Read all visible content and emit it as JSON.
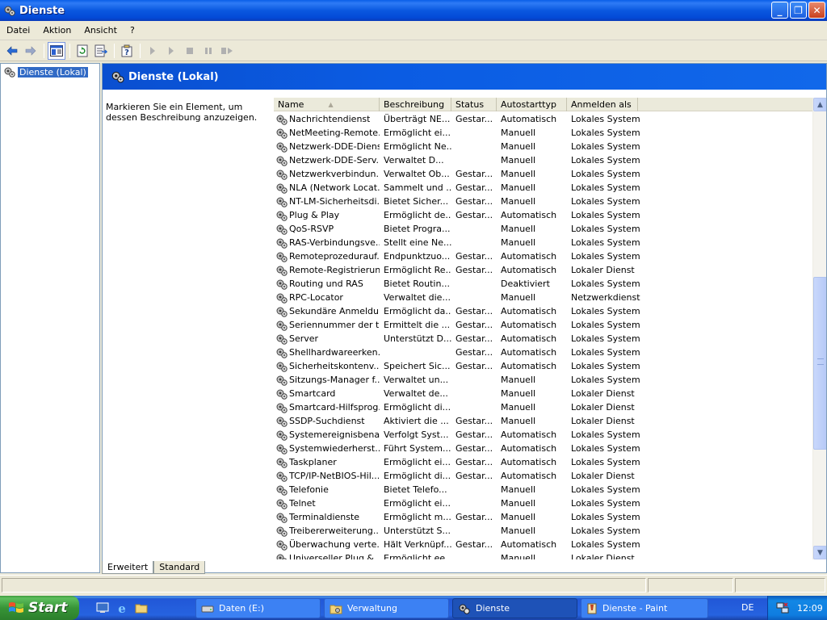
{
  "window": {
    "title": "Dienste"
  },
  "menu": [
    "Datei",
    "Aktion",
    "Ansicht",
    "?"
  ],
  "toolbar": [
    "back-icon",
    "forward-icon",
    "show-hide-tree-icon",
    "refresh-icon",
    "export-list-icon",
    "help-properties-icon",
    "start-service-icon",
    "start-icon",
    "stop-icon",
    "pause-icon",
    "restart-icon"
  ],
  "tree": {
    "root": "Dienste (Lokal)"
  },
  "pane": {
    "title": "Dienste (Lokal)",
    "description": "Markieren Sie ein Element, um dessen Beschreibung anzuzeigen."
  },
  "list": {
    "columns": [
      "Name",
      "Beschreibung",
      "Status",
      "Autostarttyp",
      "Anmelden als"
    ],
    "rows": [
      [
        "Nachrichtendienst",
        "Überträgt NE...",
        "Gestar...",
        "Automatisch",
        "Lokales System"
      ],
      [
        "NetMeeting-Remote...",
        "Ermöglicht ei...",
        "",
        "Manuell",
        "Lokales System"
      ],
      [
        "Netzwerk-DDE-Dienst",
        "Ermöglicht Ne...",
        "",
        "Manuell",
        "Lokales System"
      ],
      [
        "Netzwerk-DDE-Serv...",
        "Verwaltet D...",
        "",
        "Manuell",
        "Lokales System"
      ],
      [
        "Netzwerkverbindun...",
        "Verwaltet Ob...",
        "Gestar...",
        "Manuell",
        "Lokales System"
      ],
      [
        "NLA (Network Locat...",
        "Sammelt und ...",
        "Gestar...",
        "Manuell",
        "Lokales System"
      ],
      [
        "NT-LM-Sicherheitsdi...",
        "Bietet Sicher...",
        "Gestar...",
        "Manuell",
        "Lokales System"
      ],
      [
        "Plug & Play",
        "Ermöglicht de...",
        "Gestar...",
        "Automatisch",
        "Lokales System"
      ],
      [
        "QoS-RSVP",
        "Bietet Progra...",
        "",
        "Manuell",
        "Lokales System"
      ],
      [
        "RAS-Verbindungsve...",
        "Stellt eine Ne...",
        "",
        "Manuell",
        "Lokales System"
      ],
      [
        "Remoteprozedurauf...",
        "Endpunktzuo...",
        "Gestar...",
        "Automatisch",
        "Lokales System"
      ],
      [
        "Remote-Registrierung",
        "Ermöglicht Re...",
        "Gestar...",
        "Automatisch",
        "Lokaler Dienst"
      ],
      [
        "Routing und RAS",
        "Bietet Routin...",
        "",
        "Deaktiviert",
        "Lokales System"
      ],
      [
        "RPC-Locator",
        "Verwaltet die...",
        "",
        "Manuell",
        "Netzwerkdienst"
      ],
      [
        "Sekundäre Anmeldung",
        "Ermöglicht da...",
        "Gestar...",
        "Automatisch",
        "Lokales System"
      ],
      [
        "Seriennummer der t...",
        "Ermittelt die ...",
        "Gestar...",
        "Automatisch",
        "Lokales System"
      ],
      [
        "Server",
        "Unterstützt D...",
        "Gestar...",
        "Automatisch",
        "Lokales System"
      ],
      [
        "Shellhardwareerken...",
        "",
        "Gestar...",
        "Automatisch",
        "Lokales System"
      ],
      [
        "Sicherheitskontenv...",
        "Speichert Sic...",
        "Gestar...",
        "Automatisch",
        "Lokales System"
      ],
      [
        "Sitzungs-Manager f...",
        "Verwaltet un...",
        "",
        "Manuell",
        "Lokales System"
      ],
      [
        "Smartcard",
        "Verwaltet de...",
        "",
        "Manuell",
        "Lokaler Dienst"
      ],
      [
        "Smartcard-Hilfsprog...",
        "Ermöglicht di...",
        "",
        "Manuell",
        "Lokaler Dienst"
      ],
      [
        "SSDP-Suchdienst",
        "Aktiviert die ...",
        "Gestar...",
        "Manuell",
        "Lokaler Dienst"
      ],
      [
        "Systemereignisbena...",
        "Verfolgt Syst...",
        "Gestar...",
        "Automatisch",
        "Lokales System"
      ],
      [
        "Systemwiederherst...",
        "Führt System...",
        "Gestar...",
        "Automatisch",
        "Lokales System"
      ],
      [
        "Taskplaner",
        "Ermöglicht ei...",
        "Gestar...",
        "Automatisch",
        "Lokales System"
      ],
      [
        "TCP/IP-NetBIOS-Hil...",
        "Ermöglicht di...",
        "Gestar...",
        "Automatisch",
        "Lokaler Dienst"
      ],
      [
        "Telefonie",
        "Bietet Telefo...",
        "",
        "Manuell",
        "Lokales System"
      ],
      [
        "Telnet",
        "Ermöglicht ei...",
        "",
        "Manuell",
        "Lokales System"
      ],
      [
        "Terminaldienste",
        "Ermöglicht m...",
        "Gestar...",
        "Manuell",
        "Lokales System"
      ],
      [
        "Treibererweiterung...",
        "Unterstützt S...",
        "",
        "Manuell",
        "Lokales System"
      ],
      [
        "Überwachung verte...",
        "Hält Verknüpf...",
        "Gestar...",
        "Automatisch",
        "Lokales System"
      ],
      [
        "Universeller Plug &...",
        "Ermöglicht ee...",
        "",
        "Manuell",
        "Lokaler Dienst"
      ]
    ]
  },
  "tabs": [
    "Erweitert",
    "Standard"
  ],
  "taskbar": {
    "start": "Start",
    "tasks": [
      "Daten (E:)",
      "Verwaltung",
      "Dienste",
      "Dienste - Paint"
    ],
    "lang": "DE",
    "clock": "12:09"
  }
}
